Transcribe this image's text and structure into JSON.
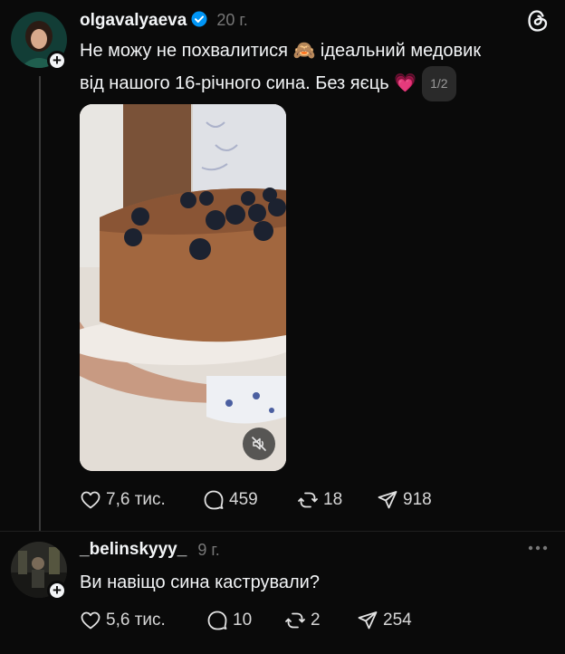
{
  "post": {
    "username": "olgavalyaeva",
    "verified": true,
    "time": "20 г.",
    "text_line1": "Не можу не похвалитися 🙈 ідеальний медовик",
    "text_line2": "від нашого 16-річного сина. Без яєць 💗",
    "media_counter": "1/2",
    "media_icon": "mute-icon",
    "actions": {
      "likes": "7,6 тис.",
      "replies": "459",
      "reposts": "18",
      "shares": "918"
    }
  },
  "reply": {
    "username": "_belinskyyy_",
    "time": "9 г.",
    "text": "Ви навіщо сина кастрували?",
    "actions": {
      "likes": "5,6 тис.",
      "replies": "10",
      "reposts": "2",
      "shares": "254"
    }
  },
  "icons": {
    "app_logo": "threads-logo-icon",
    "more": "more-dots-icon",
    "verified": "verified-badge-icon",
    "like": "heart-icon",
    "reply": "comment-icon",
    "repost": "repost-icon",
    "share": "send-icon",
    "follow": "plus-icon"
  },
  "colors": {
    "background": "#0a0a0a",
    "text": "#f3f5f7",
    "secondary": "#777777",
    "verified": "#0095f6"
  }
}
